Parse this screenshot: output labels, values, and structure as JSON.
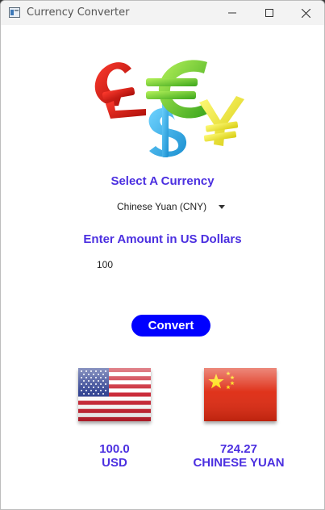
{
  "window": {
    "title": "Currency Converter"
  },
  "icons": {
    "app": "window-app-icon",
    "minimize": "minimize-icon",
    "maximize": "maximize-icon",
    "close": "close-icon",
    "logo": "currency-symbols-logo",
    "usd_flag": "us-flag-icon",
    "cny_flag": "china-flag-icon"
  },
  "colors": {
    "accent": "#4b2fe0",
    "button": "#0000ff",
    "button_text": "#ffffff"
  },
  "form": {
    "currency_heading": "Select A Currency",
    "currency_selected": "Chinese Yuan (CNY)",
    "amount_heading": "Enter Amount in US Dollars",
    "amount_value": "100",
    "convert_label": "Convert"
  },
  "results": {
    "from_amount": "100.0",
    "from_currency": "USD",
    "to_amount": "724.27",
    "to_currency": "CHINESE YUAN"
  }
}
